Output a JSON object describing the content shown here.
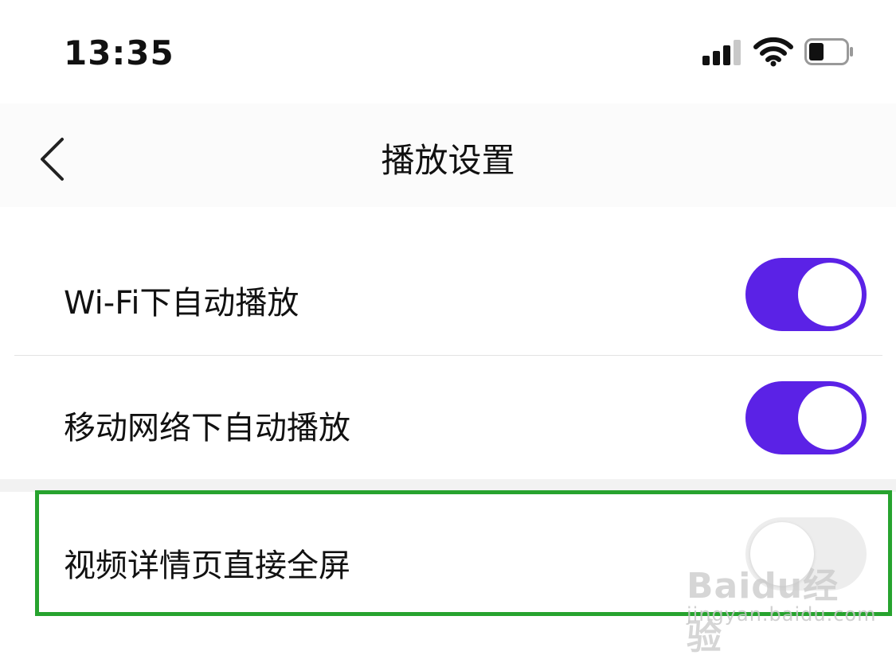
{
  "status_bar": {
    "time": "13:35"
  },
  "nav": {
    "title": "播放设置"
  },
  "settings": [
    {
      "label": "Wi-Fi下自动播放",
      "enabled": true
    },
    {
      "label": "移动网络下自动播放",
      "enabled": true
    },
    {
      "label": "视频详情页直接全屏",
      "enabled": false
    }
  ],
  "colors": {
    "toggle_on": "#5b22e6",
    "toggle_off": "#ededed",
    "highlight": "#27a32e"
  },
  "watermark": {
    "logo": "Baidu经验",
    "url": "jingyan.baidu.com"
  }
}
